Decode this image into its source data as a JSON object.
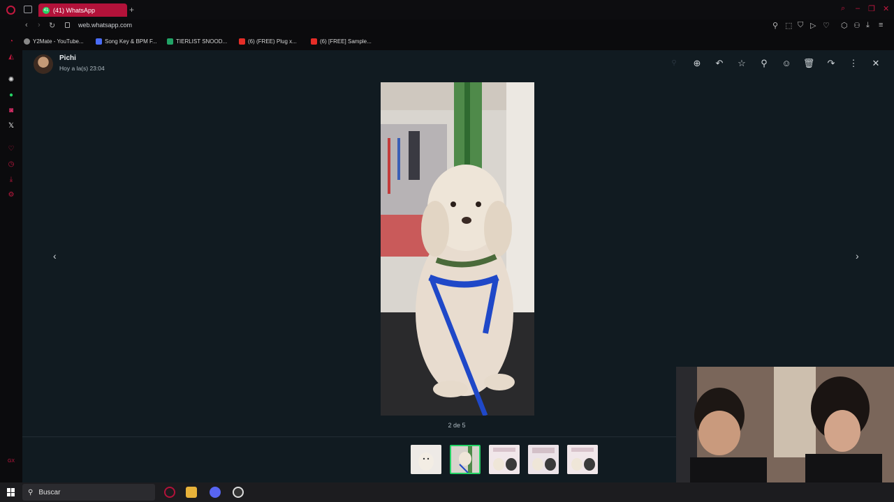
{
  "browser": {
    "tab_title": "(41) WhatsApp",
    "tab_badge": "41",
    "url": "web.whatsapp.com"
  },
  "bookmarks": [
    {
      "label": "Y2Mate - YouTube...",
      "color": "#888888"
    },
    {
      "label": "Song Key & BPM F...",
      "color": "#4a6cf7"
    },
    {
      "label": "TIERLIST SNOOD...",
      "color": "#21a366"
    },
    {
      "label": "(6) (FREE) Plug x...",
      "color": "#e52d27"
    },
    {
      "label": "(6) [FREE] Sample...",
      "color": "#e52d27"
    }
  ],
  "viewer": {
    "sender": "Pichi",
    "timestamp": "Hoy a la(s) 23:04",
    "counter": "2 de 5",
    "toolbar": [
      "zoom-in-icon",
      "reply-icon",
      "star-icon",
      "pin-icon",
      "emoji-icon",
      "delete-icon",
      "forward-icon",
      "more-icon",
      "close-icon"
    ]
  },
  "taskbar": {
    "search_placeholder": "Buscar"
  },
  "colors": {
    "accent": "#b3123a",
    "whatsapp_green": "#25d366",
    "viewer_bg": "#111b21"
  }
}
